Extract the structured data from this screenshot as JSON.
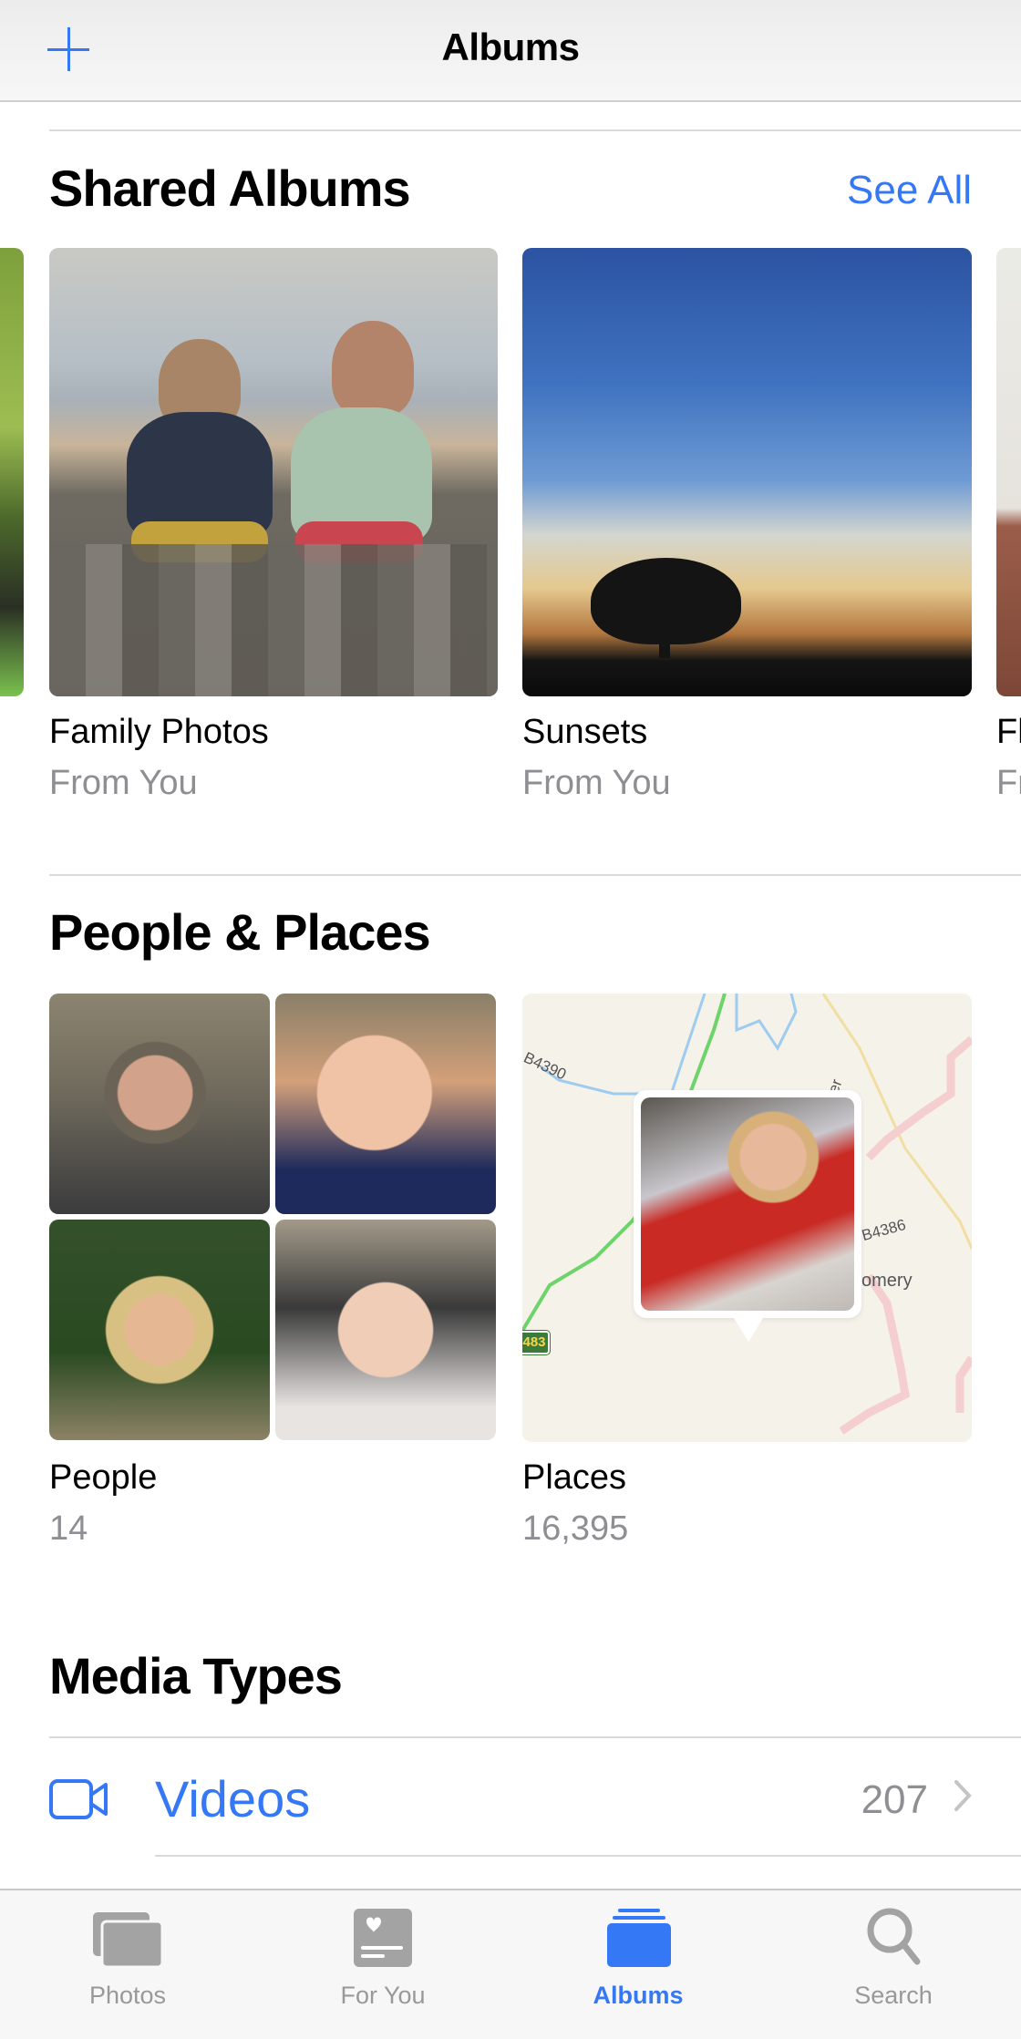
{
  "navbar": {
    "title": "Albums",
    "add_icon": "plus-icon"
  },
  "shared_albums": {
    "title": "Shared Albums",
    "see_all": "See All",
    "albums": [
      {
        "name": "Family Photos",
        "subtitle": "From You"
      },
      {
        "name": "Sunsets",
        "subtitle": "From You"
      },
      {
        "name": "Fl",
        "subtitle": "Fr"
      }
    ]
  },
  "people_places": {
    "title": "People & Places",
    "people": {
      "name": "People",
      "count": "14"
    },
    "places": {
      "name": "Places",
      "count": "16,395",
      "map_labels": [
        "B4390",
        "B4386",
        "omery",
        "er"
      ],
      "road_shield": "483"
    }
  },
  "media_types": {
    "title": "Media Types",
    "items": [
      {
        "label": "Videos",
        "count": "207",
        "icon": "video-camera-icon"
      }
    ]
  },
  "tabbar": {
    "tabs": [
      {
        "label": "Photos",
        "icon": "photos-stack-icon",
        "active": false
      },
      {
        "label": "For You",
        "icon": "for-you-heart-card-icon",
        "active": false
      },
      {
        "label": "Albums",
        "icon": "albums-stack-icon",
        "active": true
      },
      {
        "label": "Search",
        "icon": "magnifier-icon",
        "active": false
      }
    ]
  },
  "colors": {
    "accent": "#3478f6",
    "secondary_text": "#8e8e93",
    "tab_inactive": "#999999",
    "separator": "#dadada"
  }
}
